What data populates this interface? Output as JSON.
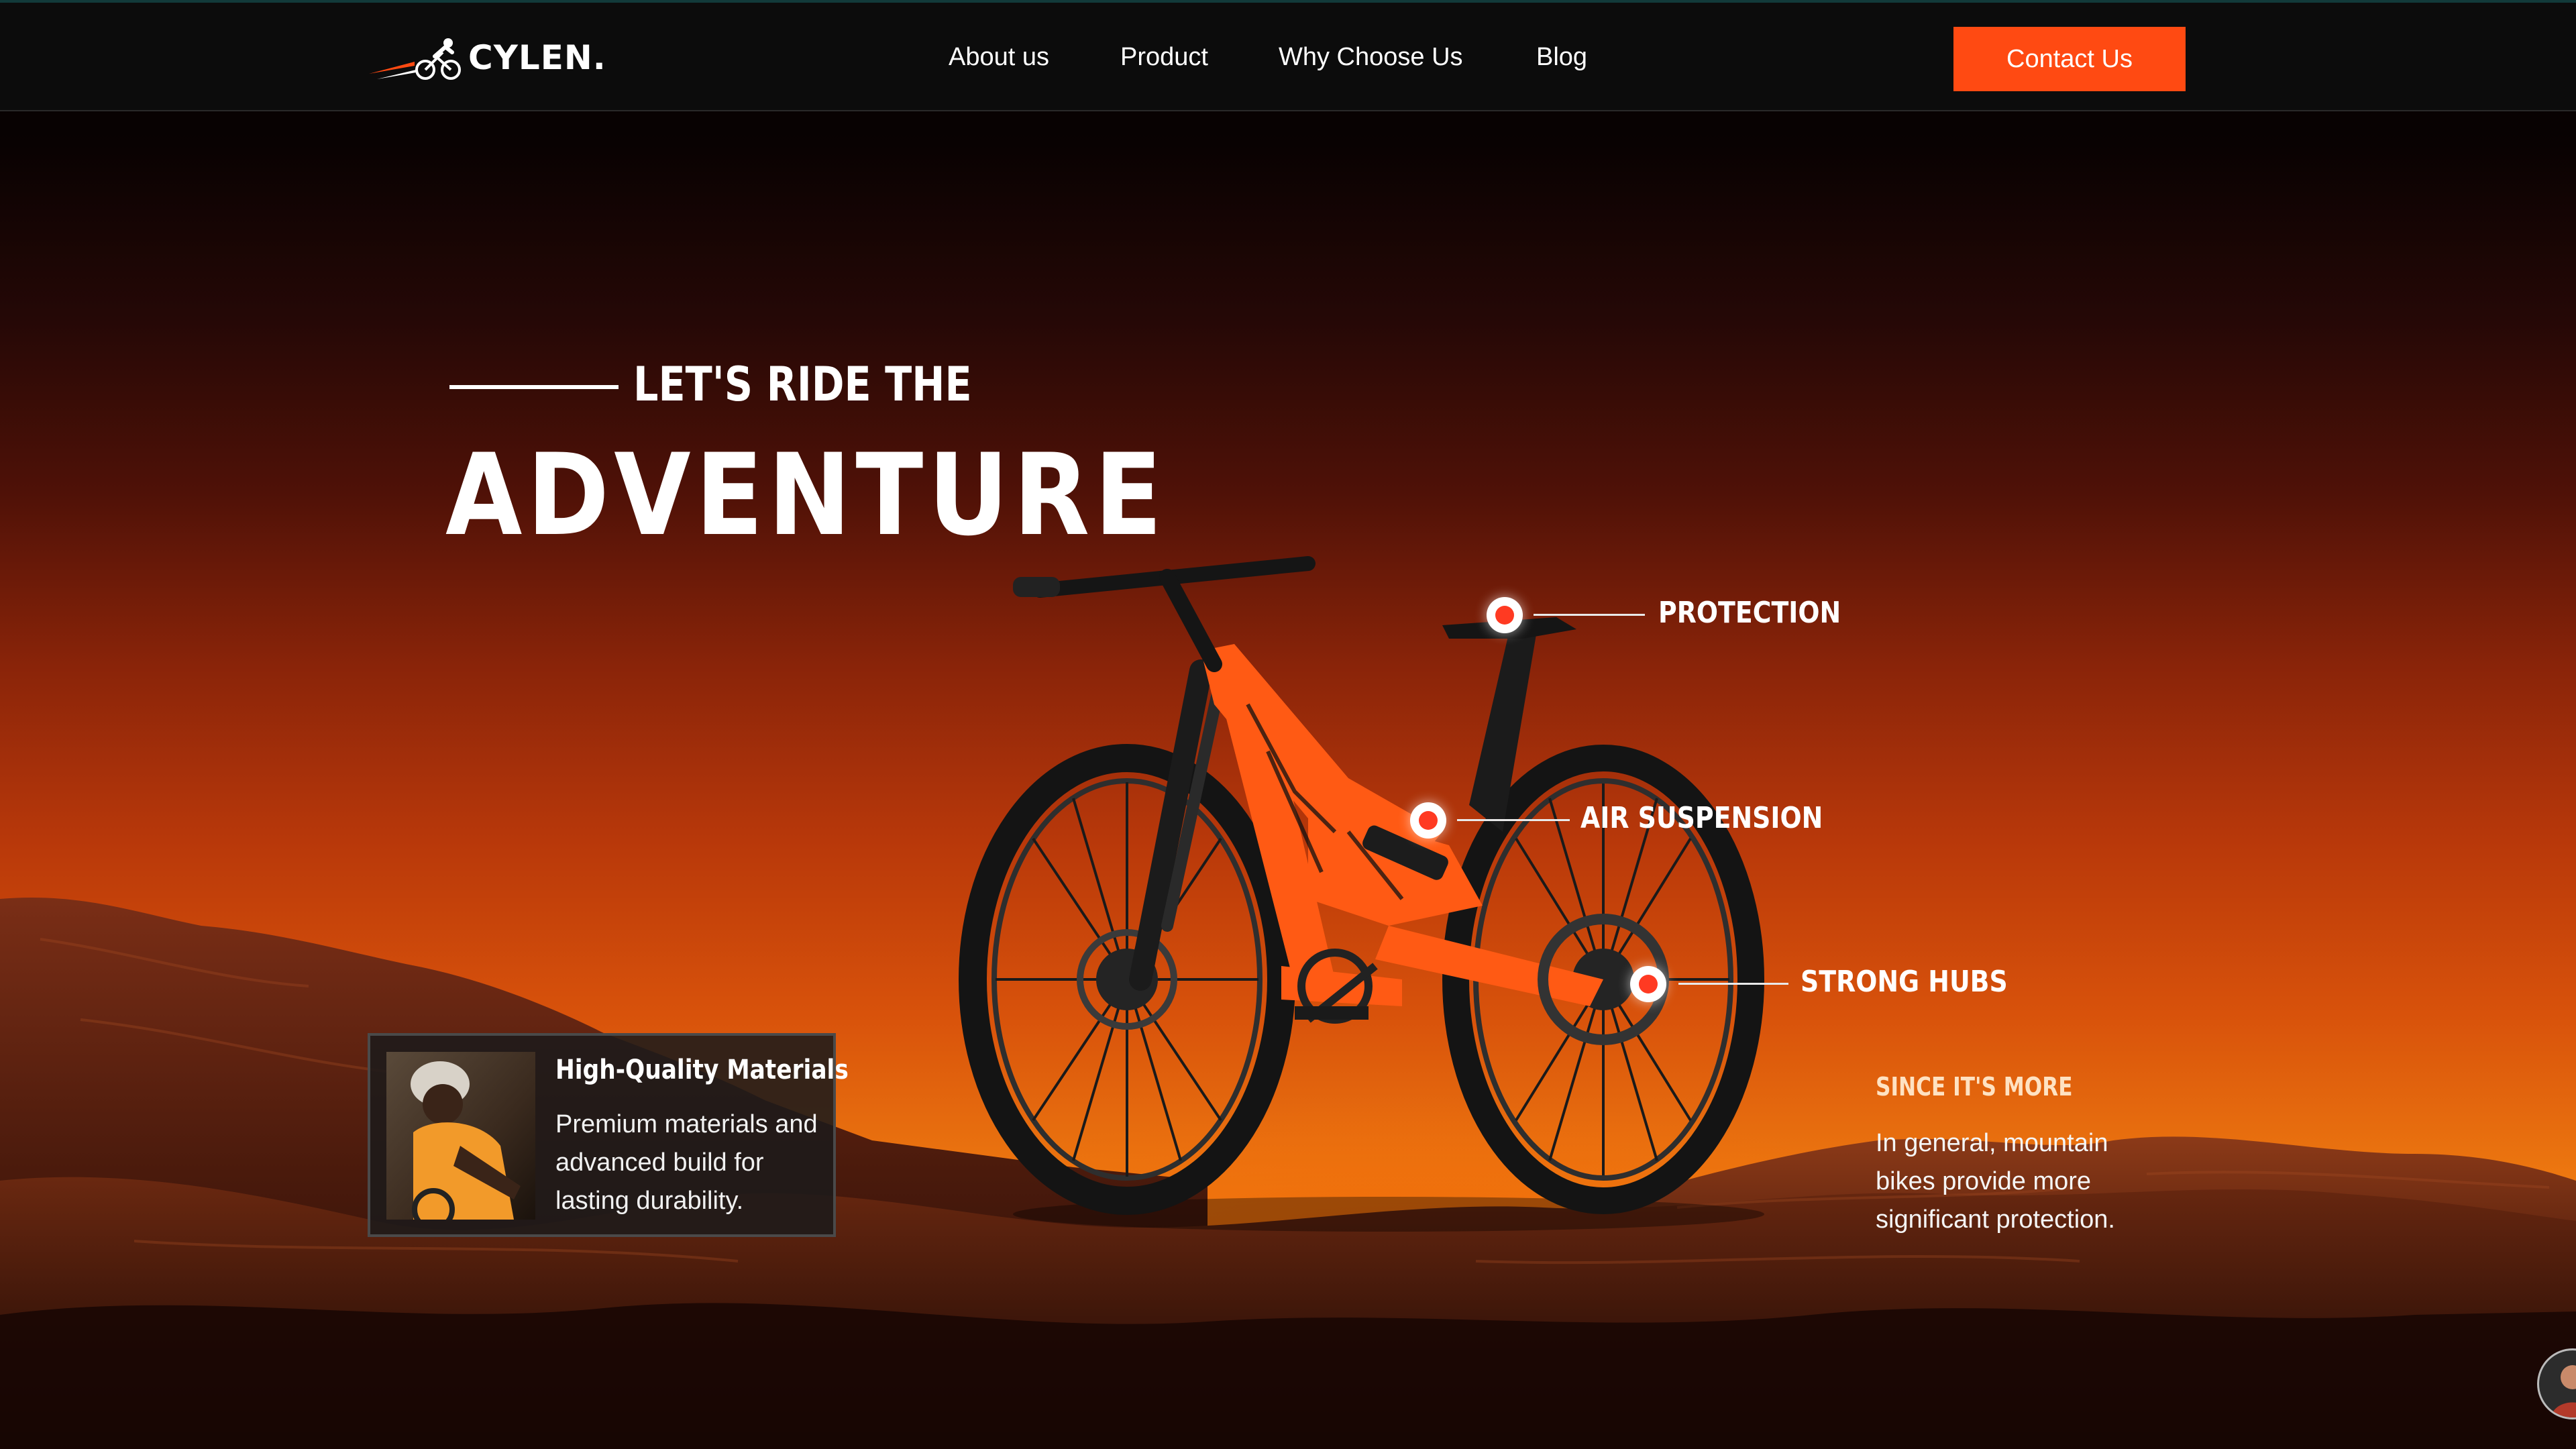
{
  "brand": {
    "name": "CYLEN.",
    "logo_icon": "cyclist-logo-icon"
  },
  "nav": {
    "links": [
      {
        "label": "About us"
      },
      {
        "label": "Product"
      },
      {
        "label": "Why Choose Us"
      },
      {
        "label": "Blog"
      }
    ],
    "cta_label": "Contact Us"
  },
  "hero": {
    "eyebrow": "LET'S RIDE THE",
    "title": "ADVENTURE"
  },
  "features": [
    {
      "label": "PROTECTION"
    },
    {
      "label": "AIR SUSPENSION"
    },
    {
      "label": "STRONG HUBS"
    }
  ],
  "card": {
    "title": "High-Quality Materials",
    "body": "Premium materials and advanced build for lasting durability."
  },
  "since": {
    "title": "SINCE IT'S MORE",
    "body": "In general, mountain bikes provide more significant protection."
  },
  "colors": {
    "accent": "#ff4a12",
    "hotspot": "#ff3a22",
    "bike": "#ff5a14",
    "navbar": "#0c0c0c"
  }
}
